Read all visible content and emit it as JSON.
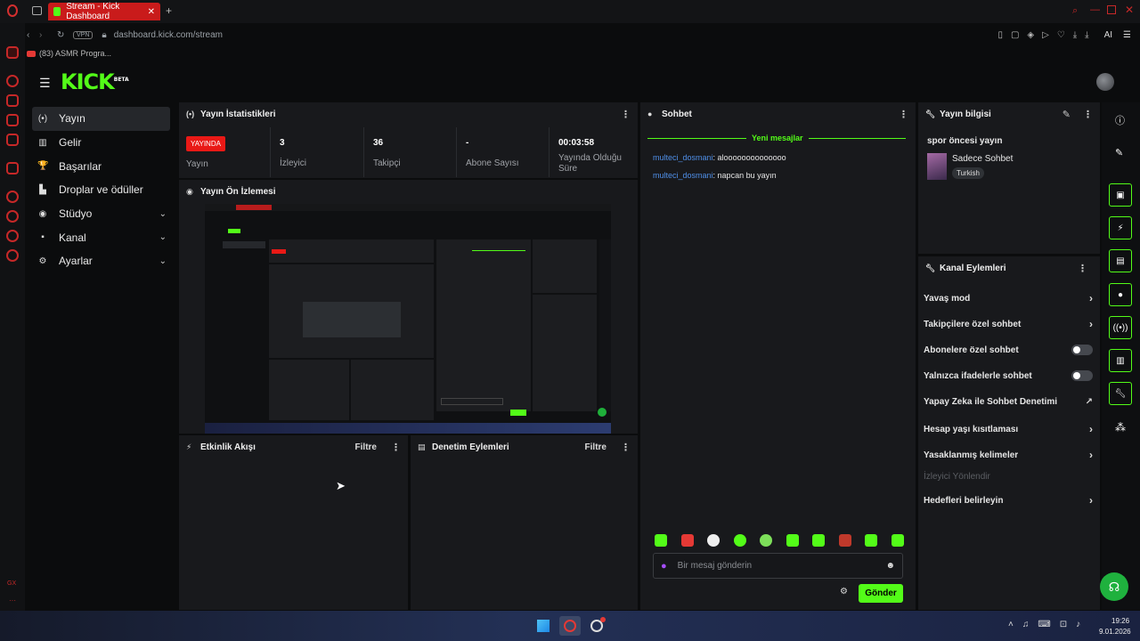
{
  "browser": {
    "tab_title": "Stream - Kick Dashboard",
    "new_tab": "+",
    "url": "dashboard.kick.com/stream",
    "vpn": "VPN",
    "ai": "AI",
    "bookmark": "(83) ASMR Progra..."
  },
  "header": {
    "logo": "KICK",
    "logo_beta": "BETA"
  },
  "nav": {
    "items": [
      {
        "label": "Yayın",
        "icon": "(•)"
      },
      {
        "label": "Gelir",
        "icon": "▥"
      },
      {
        "label": "Başarılar",
        "icon": "🏆"
      },
      {
        "label": "Droplar ve ödüller",
        "icon": "▙"
      },
      {
        "label": "Stüdyo",
        "icon": "◉",
        "chev": "⌄"
      },
      {
        "label": "Kanal",
        "icon": "▪",
        "chev": "⌄"
      },
      {
        "label": "Ayarlar",
        "icon": "⚙",
        "chev": "⌄"
      }
    ]
  },
  "stats": {
    "title": "Yayın İstatistikleri",
    "live_badge": "YAYINDA",
    "live_label": "Yayın",
    "items": [
      {
        "value": "3",
        "label": "İzleyici"
      },
      {
        "value": "36",
        "label": "Takipçi"
      },
      {
        "value": "-",
        "label": "Abone Sayısı"
      },
      {
        "value": "00:03:58",
        "label": "Yayında Olduğu Süre"
      }
    ]
  },
  "preview": {
    "title": "Yayın Ön İzlemesi"
  },
  "activity": {
    "title": "Etkinlik Akışı",
    "filter": "Filtre"
  },
  "moderation": {
    "title": "Denetim Eylemleri",
    "filter": "Filtre"
  },
  "chat": {
    "title": "Sohbet",
    "new_messages": "Yeni mesajlar",
    "messages": [
      {
        "user": "multeci_dosmani",
        "text": "aloooooooooooooo"
      },
      {
        "user": "multeci_dosmani",
        "text": "napcan bu yayın"
      }
    ],
    "placeholder": "Bir mesaj gönderin",
    "send": "Gönder"
  },
  "stream_info": {
    "title": "Yayın bilgisi",
    "stream_title": "spor öncesi yayın",
    "category": "Sadece Sohbet",
    "language": "Turkish"
  },
  "channel_actions": {
    "title": "Kanal Eylemleri",
    "items": [
      {
        "label": "Yavaş mod",
        "type": "arrow"
      },
      {
        "label": "Takipçilere özel sohbet",
        "type": "arrow"
      },
      {
        "label": "Abonelere özel sohbet",
        "type": "toggle"
      },
      {
        "label": "Yalnızca ifadelerle sohbet",
        "type": "toggle"
      },
      {
        "label": "Yapay Zeka ile Sohbet Denetimi",
        "type": "external"
      },
      {
        "label": "Hesap yaşı kısıtlaması",
        "type": "arrow"
      },
      {
        "label": "Yasaklanmış kelimeler",
        "type": "arrow"
      },
      {
        "label": "İzleyici Yönlendir",
        "type": "disabled"
      },
      {
        "label": "Hedefleri belirleyin",
        "type": "arrow"
      }
    ]
  },
  "taskbar": {
    "time": "19:26",
    "date": "9.01.2026"
  },
  "colors": {
    "accent": "#53fc18",
    "live": "#e91916",
    "username": "#4f8fe8"
  }
}
